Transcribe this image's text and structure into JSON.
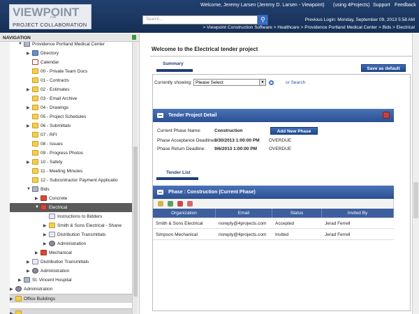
{
  "header": {
    "logo_top": "VIEWPOINT",
    "logo_for": "FOR",
    "logo_bottom": "PROJECT COLLABORATION",
    "welcome": "Welcome, Jeremy Larsen (Jeremy D. Larsen - Viewpoint)",
    "using": "(using 4Projects)",
    "support": "Support",
    "feedback": "Feedback",
    "search_placeholder": "Search...",
    "previous_login": "Previous Login:  Monday, September 09, 2013 5:58 AM",
    "breadcrumb": "> Viewpoint Construction Software > Healthcare > Providence Portland Medical Center > Bids > Electrical"
  },
  "nav": {
    "title": "NAVIGATION",
    "items": [
      {
        "label": "Providence Portland Medical Center",
        "arrow": "▼",
        "icon": "building-icon"
      },
      {
        "label": "Directory",
        "arrow": "▶",
        "icon": "directory-icon"
      },
      {
        "label": "Calendar",
        "arrow": "",
        "icon": "calendar-icon"
      },
      {
        "label": "00 - Private Team Docs",
        "arrow": "",
        "icon": "folder-icon"
      },
      {
        "label": "01 - Contracts",
        "arrow": "",
        "icon": "folder-icon"
      },
      {
        "label": "02 - Estimates",
        "arrow": "▶",
        "icon": "folder-icon"
      },
      {
        "label": "03 - Email Archive",
        "arrow": "",
        "icon": "folder-icon"
      },
      {
        "label": "04 - Drawings",
        "arrow": "▶",
        "icon": "folder-icon"
      },
      {
        "label": "05 - Project Schedules",
        "arrow": "",
        "icon": "folder-icon"
      },
      {
        "label": "06 - Submittals",
        "arrow": "▶",
        "icon": "folder-icon"
      },
      {
        "label": "07 - RFI",
        "arrow": "",
        "icon": "rfi-icon"
      },
      {
        "label": "08 - Issues",
        "arrow": "",
        "icon": "issues-icon"
      },
      {
        "label": "09 - Progress Photos",
        "arrow": "",
        "icon": "photos-icon"
      },
      {
        "label": "10 - Safety",
        "arrow": "▶",
        "icon": "folder-icon"
      },
      {
        "label": "11 - Meeting Minutes",
        "arrow": "",
        "icon": "folder-icon"
      },
      {
        "label": "12 - Subcontractor Payment Applicatio",
        "arrow": "",
        "icon": "folder-icon"
      },
      {
        "label": "Bids",
        "arrow": "▼",
        "icon": "bids-icon"
      },
      {
        "label": "Concrete",
        "arrow": "▶",
        "icon": "bid-package-icon"
      },
      {
        "label": "Electrical",
        "arrow": "▼",
        "icon": "bid-package-icon"
      },
      {
        "label": "Instructions to Bidders",
        "arrow": "",
        "icon": "document-icon"
      },
      {
        "label": "Smith & Sons Electrical - Shane",
        "arrow": "▶",
        "icon": "bidder-icon"
      },
      {
        "label": "Distribution Transmittals",
        "arrow": "▶",
        "icon": "transmittal-icon"
      },
      {
        "label": "Administration",
        "arrow": "▶",
        "icon": "admin-icon"
      },
      {
        "label": "Mechanical",
        "arrow": "▶",
        "icon": "bid-package-icon"
      },
      {
        "label": "Distribution Transmittals",
        "arrow": "▶",
        "icon": "transmittal-icon"
      },
      {
        "label": "Administration",
        "arrow": "▶",
        "icon": "admin-icon"
      },
      {
        "label": "St. Vincent Hospital",
        "arrow": "▶",
        "icon": "building-icon"
      },
      {
        "label": "Administration",
        "arrow": "▶",
        "icon": "admin-icon"
      },
      {
        "label": "Office Buildings",
        "arrow": "▶",
        "icon": "folder-icon"
      },
      {
        "label": "",
        "arrow": "▶",
        "icon": "folder-icon"
      }
    ]
  },
  "main": {
    "welcome": "Welcome to the Electrical tender project",
    "tab_summary": "Summary",
    "save_default": "Save as default",
    "showing_label": "Currently showing:",
    "showing_value": "Please Select",
    "or_search": "or Search",
    "tpd_title": "Tender Project Detail",
    "phase_name_label": "Current Phase Name:",
    "phase_name_value": "Construction",
    "add_phase": "Add New Phase",
    "acceptance_label": "Phase Acceptance Deadline:",
    "acceptance_value": "8/30/2013 1:00:00 PM",
    "acceptance_status": "OVERDUE",
    "return_label": "Phase Return Deadline:",
    "return_value": "9/6/2013 1:00:00 PM",
    "return_status": "OVERDUE",
    "tab_tender": "Tender List",
    "phase_bar": "Phase : Construction (Current Phase)",
    "grid_headers": [
      "Organization",
      "Email",
      "Status",
      "Invited By"
    ],
    "grid_rows": [
      [
        "Smith & Sons Electrical",
        "noreply@4projects.com",
        "Accepted",
        "Jerad Ferrell"
      ],
      [
        "Simpson Mechanical",
        "noreply@4projects.com",
        "Invited",
        "Jerad Ferrell"
      ]
    ]
  }
}
